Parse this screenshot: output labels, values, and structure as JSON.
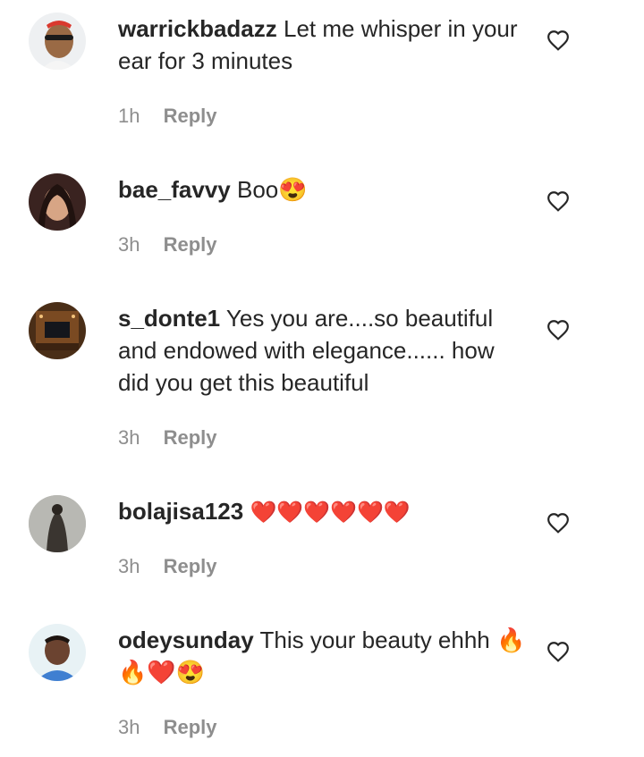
{
  "comments": [
    {
      "username": "warrickbadazz",
      "text": "Let me whisper in your ear for 3 minutes",
      "time": "1h",
      "reply": "Reply"
    },
    {
      "username": "bae_favvy",
      "text": "Boo😍",
      "time": "3h",
      "reply": "Reply"
    },
    {
      "username": "s_donte1",
      "text": "Yes you are....so beautiful and endowed with elegance...... how did you get this beautiful",
      "time": "3h",
      "reply": "Reply"
    },
    {
      "username": "bolajisa123",
      "text": "❤️❤️❤️❤️❤️❤️",
      "time": "3h",
      "reply": "Reply"
    },
    {
      "username": "odeysunday",
      "text": "This your beauty ehhh 🔥🔥❤️😍",
      "time": "3h",
      "reply": "Reply"
    }
  ],
  "icons": {
    "like": "heart-outline-icon"
  },
  "colors": {
    "text": "#262626",
    "muted": "#8e8e8e",
    "background": "#ffffff"
  }
}
